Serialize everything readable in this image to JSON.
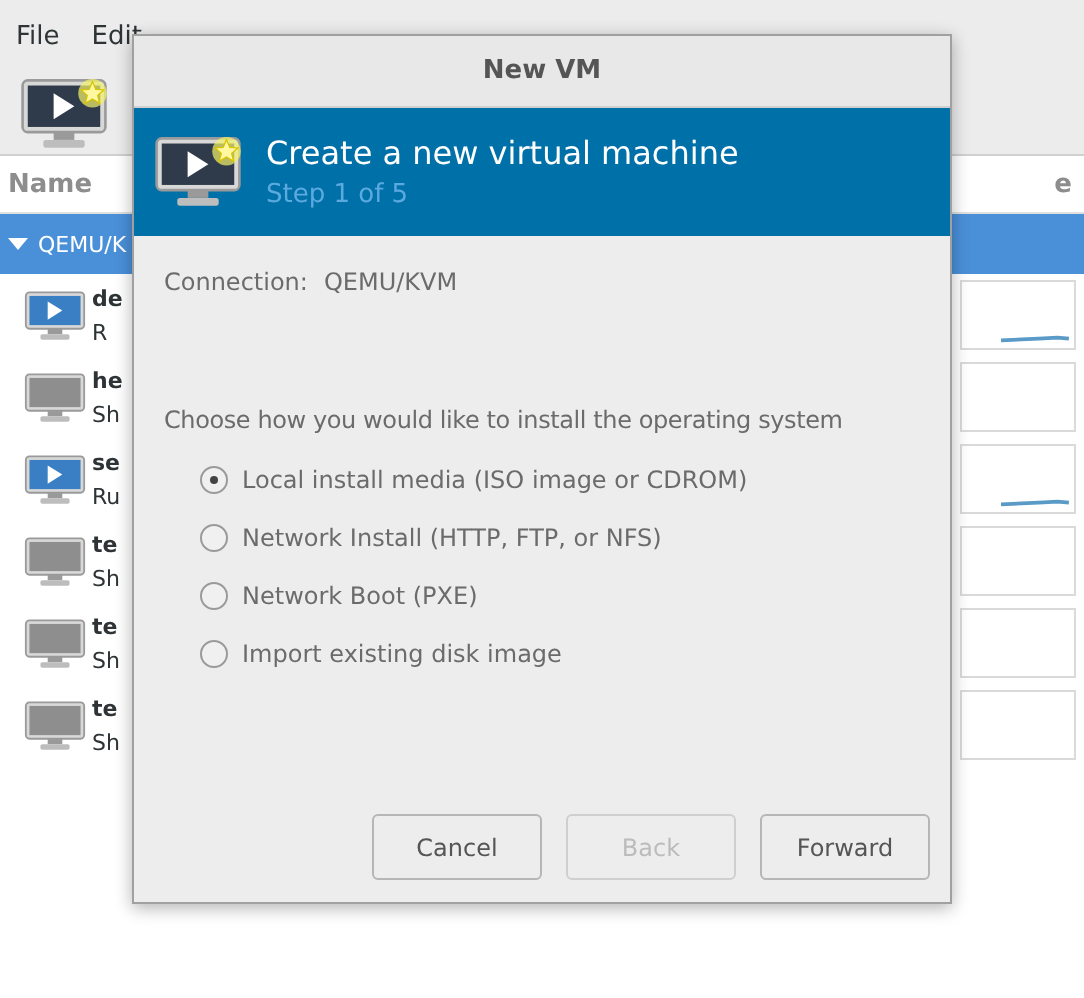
{
  "main_window": {
    "menu": [
      "File",
      "Edit"
    ],
    "column_header": "Name",
    "column_header_2": "e",
    "group": {
      "label": "QEMU/K",
      "expanded": true
    },
    "vms": [
      {
        "name": "de",
        "status": "R",
        "running": true
      },
      {
        "name": "he",
        "status": "Sh",
        "running": false
      },
      {
        "name": "se",
        "status": "Ru",
        "running": true
      },
      {
        "name": "te",
        "status": "Sh",
        "running": false
      },
      {
        "name": "te",
        "status": "Sh",
        "running": false
      },
      {
        "name": "te",
        "status": "Sh",
        "running": false
      }
    ]
  },
  "dialog": {
    "title": "New VM",
    "banner_title": "Create a new virtual machine",
    "banner_step": "Step 1 of 5",
    "connection_label": "Connection:",
    "connection_value": "QEMU/KVM",
    "prompt": "Choose how you would like to install the operating system",
    "options": [
      {
        "label": "Local install media (ISO image or CDROM)",
        "selected": true
      },
      {
        "label": "Network Install (HTTP, FTP, or NFS)",
        "selected": false
      },
      {
        "label": "Network Boot (PXE)",
        "selected": false
      },
      {
        "label": "Import existing disk image",
        "selected": false
      }
    ],
    "buttons": [
      {
        "label": "Cancel",
        "disabled": false
      },
      {
        "label": "Back",
        "disabled": true
      },
      {
        "label": "Forward",
        "disabled": false
      }
    ]
  }
}
